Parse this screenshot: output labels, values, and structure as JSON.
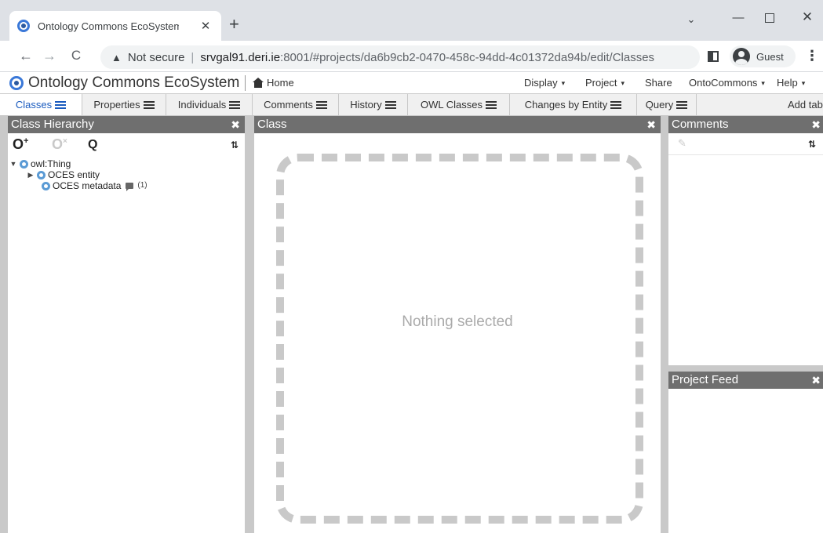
{
  "browser": {
    "tab_title": "Ontology Commons EcoSystem - ",
    "tab_close": "✕",
    "new_tab": "+",
    "window_controls": {
      "chevron": "⌄",
      "minimize": "—",
      "close": "✕"
    },
    "nav": {
      "back": "←",
      "forward": "→",
      "reload": "C"
    },
    "address": {
      "security_label": "Not secure",
      "separator": "|",
      "host": "srvgal91.deri.ie",
      "path": ":8001/#projects/da6b9cb2-0470-458c-94dd-4c01372da94b/edit/Classes"
    },
    "profile_label": "Guest",
    "menu_icon": "⋮"
  },
  "app": {
    "title": "Ontology Commons EcoSystem",
    "home": "Home",
    "menus": {
      "display": "Display",
      "project": "Project",
      "share": "Share",
      "ontocommons": "OntoCommons",
      "help": "Help"
    },
    "caret": "▾"
  },
  "perspectives": {
    "tabs": [
      {
        "label": "Classes"
      },
      {
        "label": "Properties"
      },
      {
        "label": "Individuals"
      },
      {
        "label": "Comments"
      },
      {
        "label": "History"
      },
      {
        "label": "OWL Classes"
      },
      {
        "label": "Changes by Entity"
      },
      {
        "label": "Query"
      }
    ],
    "active": "Classes",
    "add_tab": "Add tab"
  },
  "class_hierarchy": {
    "title": "Class Hierarchy",
    "close": "✖",
    "tools": {
      "create": "O",
      "delete": "O",
      "search": "Q",
      "settings": "⇅"
    },
    "tree": [
      {
        "label": "owl:Thing",
        "expanded": true,
        "level": 0
      },
      {
        "label": "OCES entity",
        "expanded": false,
        "level": 1
      },
      {
        "label": "OCES metadata",
        "level": 1,
        "comment_count": "(1)"
      }
    ]
  },
  "class_panel": {
    "title": "Class",
    "close": "✖",
    "empty_message": "Nothing selected"
  },
  "comments_panel": {
    "title": "Comments",
    "close": "✖",
    "add_icon": "✎",
    "settings_icon": "⇅"
  },
  "project_feed": {
    "title": "Project Feed",
    "close": "✖"
  },
  "colors": {
    "panel_header": "#6f6f6f",
    "active_tab_text": "#1a5bbf",
    "class_icon": "#5b9bd5",
    "placeholder_text": "#aaaaaa"
  }
}
